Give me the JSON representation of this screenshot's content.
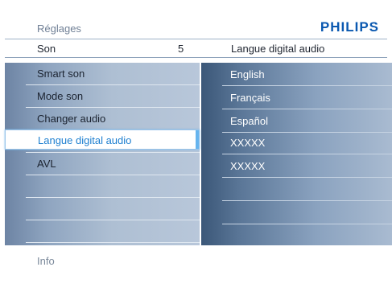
{
  "header": {
    "title": "Réglages",
    "brand": "PHILIPS",
    "sub_left": "Son",
    "sub_number": "5",
    "sub_right": "Langue digital audio"
  },
  "menu": {
    "items": [
      {
        "label": "Smart son"
      },
      {
        "label": "Mode son"
      },
      {
        "label": "Changer audio"
      },
      {
        "label": "Langue digital audio",
        "selected": true
      },
      {
        "label": "AVL"
      },
      {
        "label": ""
      },
      {
        "label": ""
      },
      {
        "label": ""
      }
    ]
  },
  "options": {
    "items": [
      {
        "label": "English"
      },
      {
        "label": "Français"
      },
      {
        "label": "Español"
      },
      {
        "label": "XXXXX"
      },
      {
        "label": "XXXXX"
      },
      {
        "label": ""
      },
      {
        "label": ""
      },
      {
        "label": ""
      }
    ]
  },
  "footer": {
    "info": "Info"
  },
  "colors": {
    "brand": "#0a58b0",
    "selection": "#1d7fd0"
  }
}
